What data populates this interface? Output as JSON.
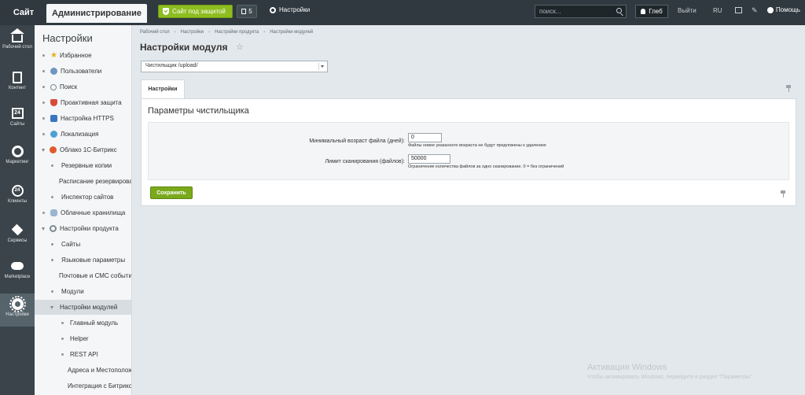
{
  "topbar": {
    "site_tab": "Сайт",
    "admin_tab": "Администрирование",
    "protect_button": "Сайт под защитой",
    "notifications_count": "5",
    "settings_label": "Настройки",
    "search_placeholder": "поиск...",
    "user_name": "Глеб",
    "logout": "Выйти",
    "lang": "RU",
    "help": "Помощь"
  },
  "leftnav": [
    {
      "label": "Рабочий стол",
      "icon": "home-icon"
    },
    {
      "label": "Контент",
      "icon": "document-icon"
    },
    {
      "label": "Сайты",
      "icon": "calendar-icon"
    },
    {
      "label": "Маркетинг",
      "icon": "target-icon"
    },
    {
      "label": "Клиенты",
      "icon": "clients-icon"
    },
    {
      "label": "Сервисы",
      "icon": "layers-icon"
    },
    {
      "label": "Marketplace",
      "icon": "cloud-icon"
    },
    {
      "label": "Настройки",
      "icon": "gear-icon"
    }
  ],
  "sidebar": {
    "title": "Настройки",
    "items": [
      "Избранное",
      "Пользователи",
      "Поиск",
      "Проактивная защита",
      "Настройка HTTPS",
      "Локализация",
      "Облако 1С-Битрикс",
      "Резервные копии",
      "Расписание резервирован",
      "Инспектор сайтов",
      "Облачные хранилища",
      "Настройки продукта",
      "Сайты",
      "Языковые параметры",
      "Почтовые и СМС события",
      "Модули",
      "Настройки модулей",
      "Главный модуль",
      "Helper",
      "REST API",
      "Адреса и Местоположе",
      "Интеграция с Битрикс2"
    ]
  },
  "breadcrumbs": [
    "Рабочий стол",
    "Настройки",
    "Настройки продукта",
    "Настройки модулей"
  ],
  "page_title": "Настройки модуля",
  "module_select": "Чистильщик /upload/",
  "tab": "Настройки",
  "panel": {
    "title": "Параметры чистильщика",
    "fields": [
      {
        "label": "Минимальный возраст файла (дней):",
        "value": "0",
        "hint": "Файлы новее указанного возраста не будут предложены к удалению"
      },
      {
        "label": "Лимит сканирования (файлов):",
        "value": "50000",
        "hint": "Ограничение количества файлов за одно сканирование. 0 = без ограничений"
      }
    ],
    "save": "Сохранить"
  },
  "watermark": {
    "title": "Активация Windows",
    "text": "Чтобы активировать Windows, перейдите в раздел \"Параметры\"."
  }
}
